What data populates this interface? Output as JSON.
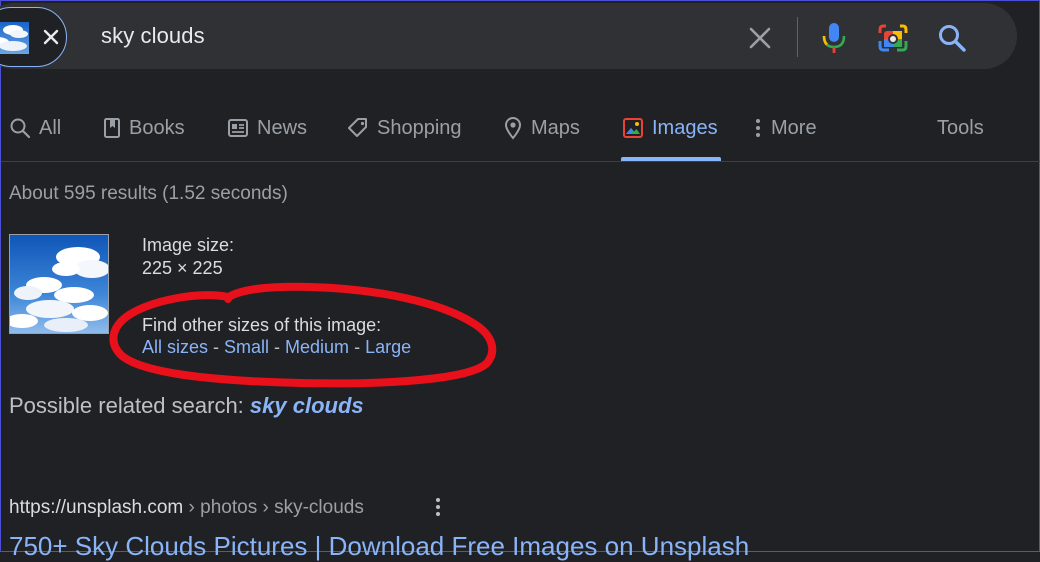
{
  "search": {
    "query": "sky clouds"
  },
  "tabs": [
    {
      "label": "All",
      "icon": "search-icon"
    },
    {
      "label": "Books",
      "icon": "book-icon"
    },
    {
      "label": "News",
      "icon": "news-icon"
    },
    {
      "label": "Shopping",
      "icon": "tag-icon"
    },
    {
      "label": "Maps",
      "icon": "map-pin-icon"
    },
    {
      "label": "Images",
      "icon": "images-icon",
      "active": true
    },
    {
      "label": "More",
      "icon": "more-vertical-icon"
    },
    {
      "label": "Tools"
    }
  ],
  "results": {
    "count_text": "About 595 results (1.52 seconds)"
  },
  "image_info": {
    "size_label": "Image size:",
    "size_value": "225 × 225",
    "other_sizes_label": "Find other sizes of this image:",
    "links": [
      "All sizes",
      "Small",
      "Medium",
      "Large"
    ],
    "separator": " - "
  },
  "related": {
    "prefix": "Possible related search: ",
    "link": "sky clouds"
  },
  "first_result": {
    "domain": "https://unsplash.com",
    "crumbs": " › photos › sky-clouds",
    "title": "750+ Sky Clouds Pictures | Download Free Images on Unsplash"
  },
  "colors": {
    "background": "#202124",
    "link": "#8ab4f8",
    "annotation": "#e8101a"
  }
}
